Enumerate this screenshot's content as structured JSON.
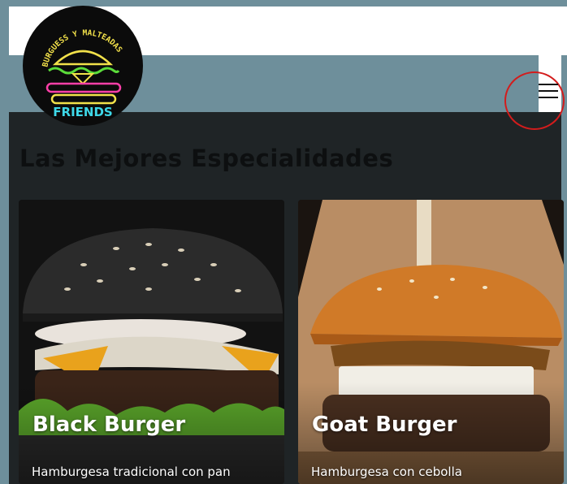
{
  "brand": {
    "logo_text_top": "BURGUESS Y MALTEADAS",
    "logo_text_bottom": "FRIENDS"
  },
  "header": {
    "menu_icon": "hamburger-menu-icon",
    "highlight_color": "#d31c1c"
  },
  "main": {
    "title": "Las Mejores Especialidades",
    "cards": [
      {
        "title": "Black Burger",
        "description": "Hamburgesa tradicional con pan"
      },
      {
        "title": "Goat Burger",
        "description": "Hamburgesa con cebolla"
      }
    ]
  },
  "colors": {
    "background": "#6e8f9b",
    "content_bg": "#1f2426",
    "logo_bg": "#0b0b0b",
    "neon_yellow": "#f2e14a",
    "neon_green": "#5bdc3a",
    "neon_pink": "#ff3fa8",
    "neon_cyan": "#3ed8e8"
  }
}
